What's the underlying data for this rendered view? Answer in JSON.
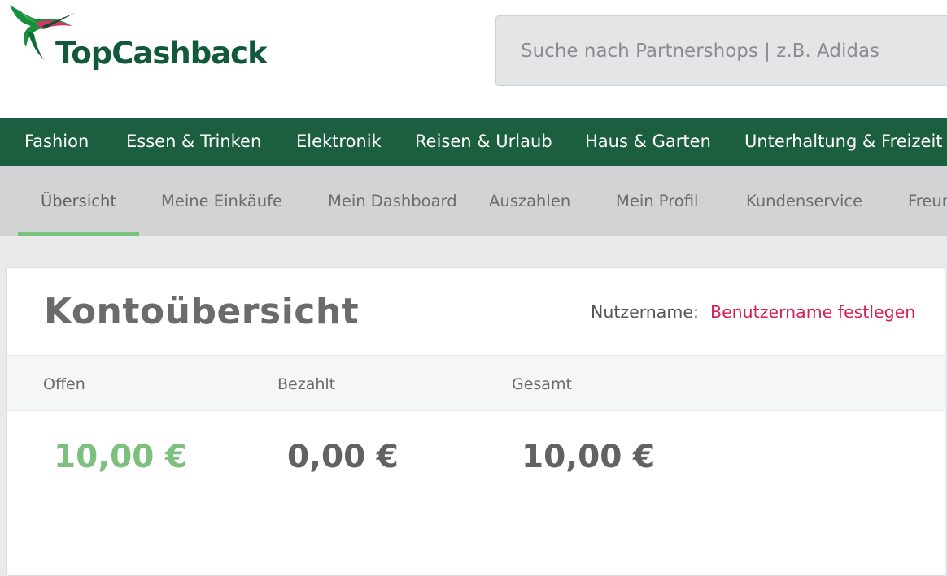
{
  "brand": {
    "name": "TopCashback",
    "logo_text_color": "#12593a",
    "bird_colors": [
      "#1b8e3e",
      "#d9326b"
    ]
  },
  "search": {
    "placeholder": "Suche nach Partnershops | z.B. Adidas"
  },
  "category_nav": {
    "background": "#1b5e40",
    "items": [
      {
        "label": "Fashion"
      },
      {
        "label": "Essen & Trinken"
      },
      {
        "label": "Elektronik"
      },
      {
        "label": "Reisen & Urlaub"
      },
      {
        "label": "Haus & Garten"
      },
      {
        "label": "Unterhaltung & Freizeit"
      }
    ]
  },
  "account_nav": {
    "active_index": 0,
    "active_underline_color": "#79c279",
    "items": [
      {
        "label": "Übersicht"
      },
      {
        "label": "Meine Einkäufe"
      },
      {
        "label": "Mein Dashboard"
      },
      {
        "label": "Auszahlen"
      },
      {
        "label": "Mein Profil"
      },
      {
        "label": "Kundenservice"
      },
      {
        "label": "Freunde werben"
      }
    ]
  },
  "overview": {
    "title": "Kontoübersicht",
    "username_label": "Nutzername:",
    "username_link": "Benutzername festlegen",
    "columns": [
      {
        "label": "Offen",
        "amount": "10,00 €"
      },
      {
        "label": "Bezahlt",
        "amount": "0,00 €"
      },
      {
        "label": "Gesamt",
        "amount": "10,00 €"
      }
    ],
    "colors": {
      "open_amount": "#7dc07e",
      "link": "#d7205a"
    }
  }
}
